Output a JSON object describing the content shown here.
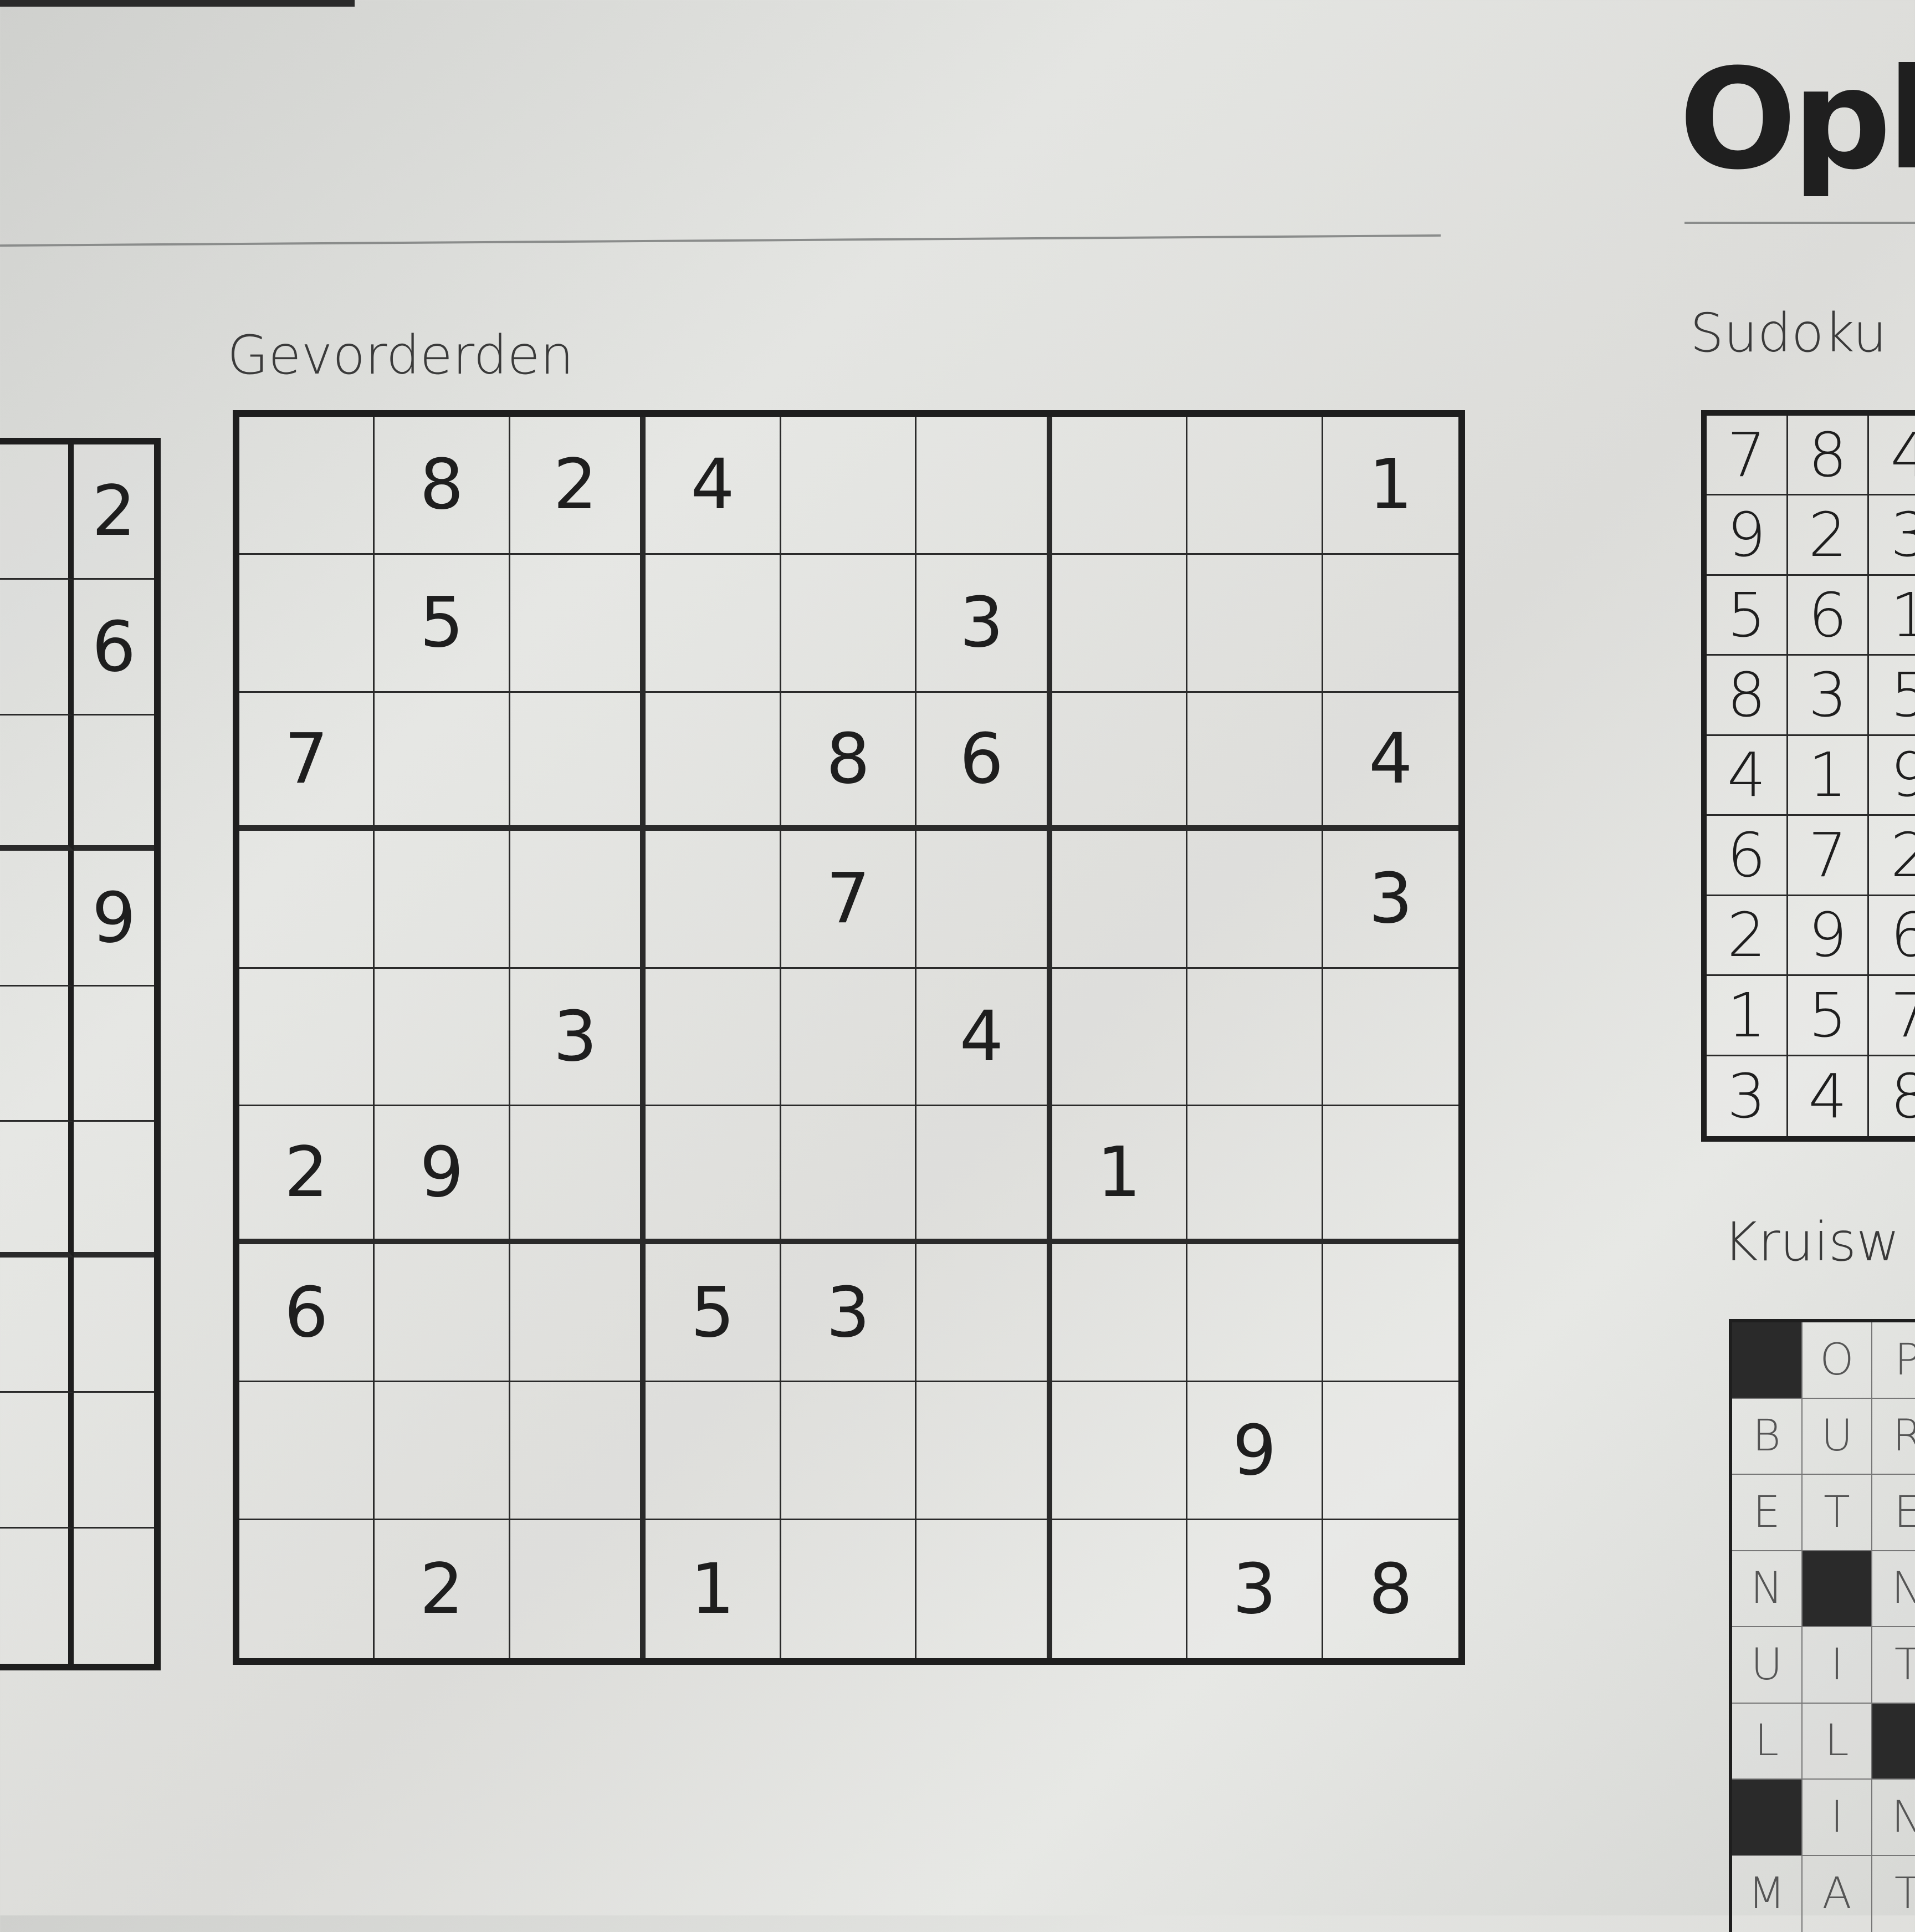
{
  "page": {
    "heading_partial": "Opl"
  },
  "sections": {
    "main_label": "Gevorderden",
    "solutions_label_partial": "Sudoku",
    "crossword_label_partial": "Kruisw"
  },
  "main_sudoku": {
    "rows": [
      [
        "",
        "8",
        "2",
        "4",
        "",
        "",
        "",
        "",
        "1"
      ],
      [
        "",
        "5",
        "",
        "",
        "",
        "3",
        "",
        "",
        ""
      ],
      [
        "7",
        "",
        "",
        "",
        "8",
        "6",
        "",
        "",
        "4"
      ],
      [
        "",
        "",
        "",
        "",
        "7",
        "",
        "",
        "",
        "3"
      ],
      [
        "",
        "",
        "3",
        "",
        "",
        "4",
        "",
        "",
        ""
      ],
      [
        "2",
        "9",
        "",
        "",
        "",
        "",
        "1",
        "",
        ""
      ],
      [
        "6",
        "",
        "",
        "5",
        "3",
        "",
        "",
        "",
        ""
      ],
      [
        "",
        "",
        "",
        "",
        "",
        "",
        "",
        "9",
        ""
      ],
      [
        "",
        "2",
        "",
        "1",
        "",
        "",
        "",
        "3",
        "8"
      ]
    ]
  },
  "left_sudoku_partial": {
    "rows": [
      [
        "",
        "2"
      ],
      [
        "",
        "6"
      ],
      [
        "",
        ""
      ],
      [
        "",
        "9"
      ],
      [
        "",
        ""
      ],
      [
        "",
        ""
      ],
      [
        "",
        ""
      ],
      [
        "",
        ""
      ],
      [
        "",
        ""
      ]
    ]
  },
  "solution_partial": {
    "rows": [
      [
        "7",
        "8",
        "4"
      ],
      [
        "9",
        "2",
        "3"
      ],
      [
        "5",
        "6",
        "1"
      ],
      [
        "8",
        "3",
        "5"
      ],
      [
        "4",
        "1",
        "9"
      ],
      [
        "6",
        "7",
        "2"
      ],
      [
        "2",
        "9",
        "6"
      ],
      [
        "1",
        "5",
        "7"
      ],
      [
        "3",
        "4",
        "8"
      ]
    ]
  },
  "crossword_solution_partial": {
    "rows": [
      [
        "#",
        "O",
        "P"
      ],
      [
        "B",
        "U",
        "R"
      ],
      [
        "E",
        "T",
        "E"
      ],
      [
        "N",
        "#",
        "N"
      ],
      [
        "U",
        "I",
        "T"
      ],
      [
        "L",
        "L",
        "#"
      ],
      [
        "#",
        "I",
        "N"
      ],
      [
        "M",
        "A",
        "T"
      ]
    ]
  }
}
